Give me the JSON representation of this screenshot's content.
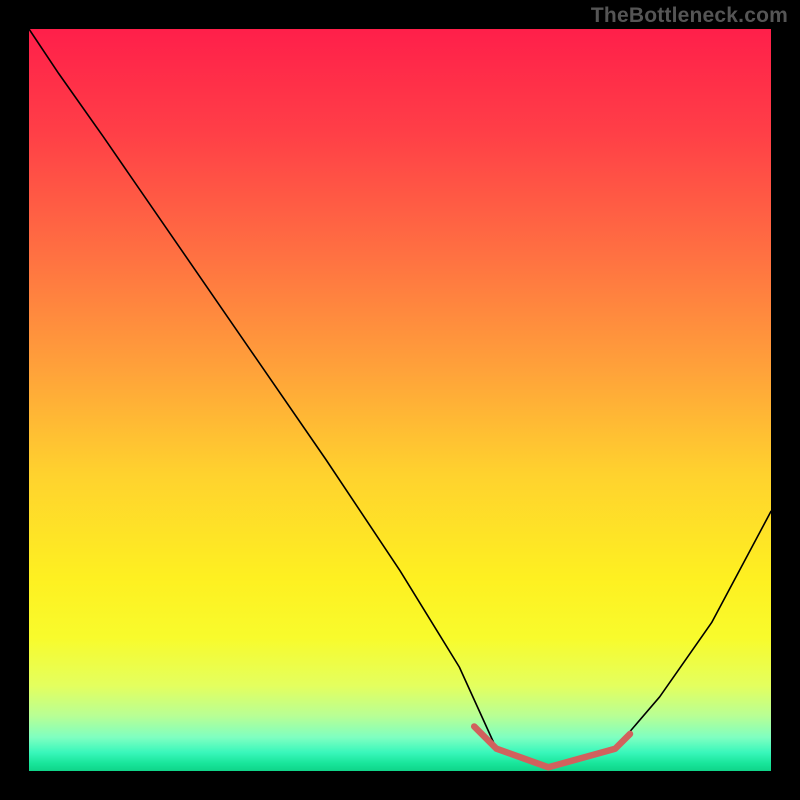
{
  "watermark": "TheBottleneck.com",
  "chart_data": {
    "type": "line",
    "title": "",
    "xlabel": "",
    "ylabel": "",
    "xlim": [
      0,
      100
    ],
    "ylim": [
      0,
      100
    ],
    "main_curve_note": "V-shaped curve; y ≈ 100 at x=0, descends to ~0 near x≈63–79, rises to ~35 at x=100. No numeric axis labels are rendered.",
    "series": [
      {
        "name": "bottleneck-curve",
        "color": "#000000",
        "x": [
          0,
          4,
          10,
          20,
          30,
          40,
          50,
          58,
          63,
          70,
          79,
          85,
          92,
          100
        ],
        "y": [
          100,
          94,
          85.5,
          71,
          56.5,
          42,
          27,
          14,
          3,
          0.5,
          3,
          10,
          20,
          35
        ]
      },
      {
        "name": "highlight-segment",
        "color": "#d1615d",
        "x": [
          60,
          63,
          70,
          79,
          81
        ],
        "y": [
          6,
          3,
          0.5,
          3,
          5
        ]
      }
    ],
    "gradient_stops": [
      {
        "pos": 0.0,
        "color": "#ff1f4a"
      },
      {
        "pos": 0.14,
        "color": "#ff3f47"
      },
      {
        "pos": 0.3,
        "color": "#ff6f42"
      },
      {
        "pos": 0.46,
        "color": "#ffa23a"
      },
      {
        "pos": 0.6,
        "color": "#ffd22e"
      },
      {
        "pos": 0.74,
        "color": "#fef021"
      },
      {
        "pos": 0.82,
        "color": "#f8fb2c"
      },
      {
        "pos": 0.885,
        "color": "#e4ff5e"
      },
      {
        "pos": 0.925,
        "color": "#b9ff94"
      },
      {
        "pos": 0.955,
        "color": "#7effc1"
      },
      {
        "pos": 0.975,
        "color": "#39f7bb"
      },
      {
        "pos": 0.99,
        "color": "#18e59a"
      },
      {
        "pos": 1.0,
        "color": "#0fd489"
      }
    ]
  }
}
